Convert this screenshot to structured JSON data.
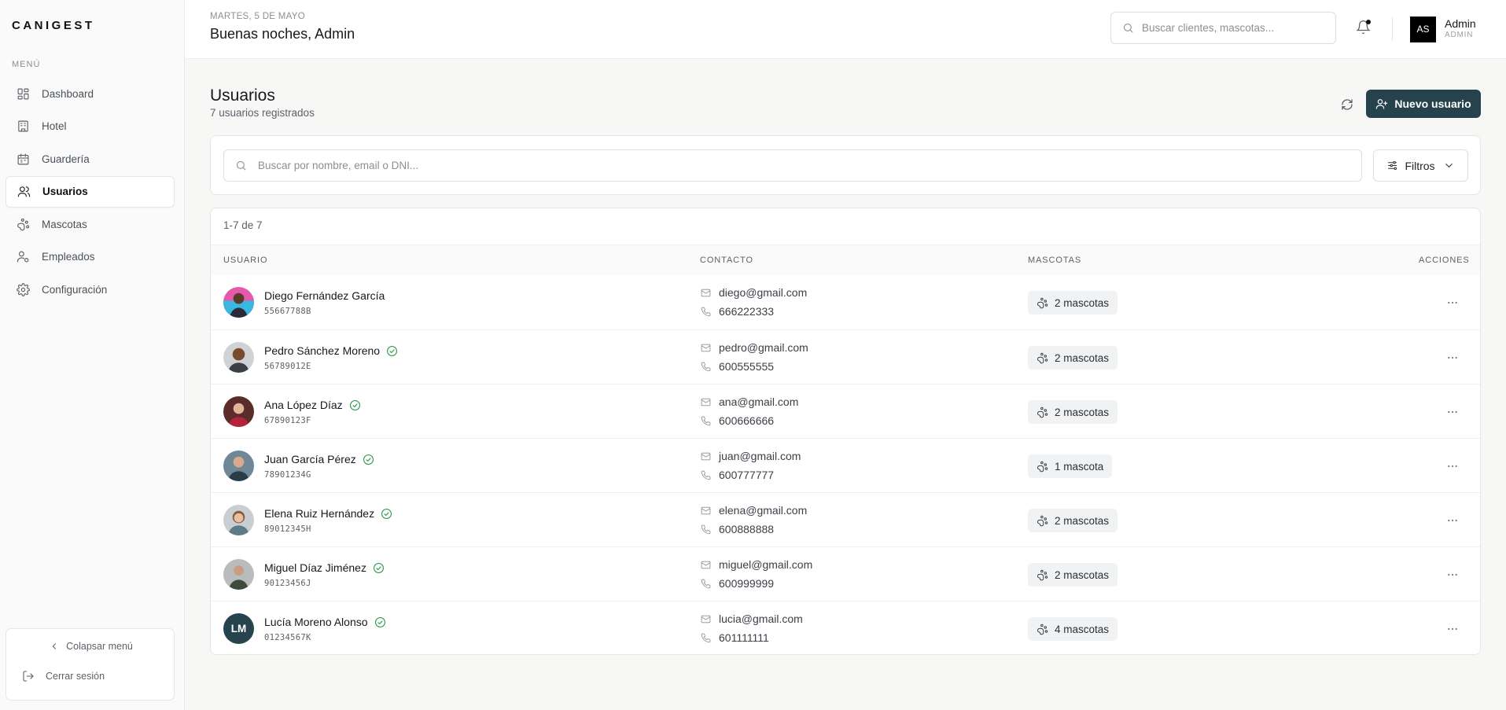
{
  "app": {
    "logo": "CANIGEST"
  },
  "sidebar": {
    "menu_label": "MENÚ",
    "items": [
      {
        "label": "Dashboard",
        "icon": "dashboard-icon",
        "active": false
      },
      {
        "label": "Hotel",
        "icon": "building-icon",
        "active": false
      },
      {
        "label": "Guardería",
        "icon": "calendar-icon",
        "active": false
      },
      {
        "label": "Usuarios",
        "icon": "users-icon",
        "active": true
      },
      {
        "label": "Mascotas",
        "icon": "paw-icon",
        "active": false
      },
      {
        "label": "Empleados",
        "icon": "employee-icon",
        "active": false
      },
      {
        "label": "Configuración",
        "icon": "gear-icon",
        "active": false
      }
    ],
    "collapse_label": "Colapsar menú",
    "logout_label": "Cerrar sesión"
  },
  "header": {
    "date": "MARTES, 5 DE MAYO",
    "greeting": "Buenas noches, Admin",
    "search_placeholder": "Buscar clientes, mascotas...",
    "user": {
      "initials": "AS",
      "name": "Admin",
      "role": "ADMIN"
    }
  },
  "page": {
    "title": "Usuarios",
    "subtitle": "7 usuarios registrados",
    "new_button": "Nuevo usuario",
    "search_placeholder": "Buscar por nombre, email o DNI...",
    "filters_button": "Filtros"
  },
  "table": {
    "range": "1-7 de 7",
    "columns": {
      "user": "USUARIO",
      "contact": "CONTACTO",
      "pets": "MASCOTAS",
      "actions": "ACCIONES"
    },
    "rows": [
      {
        "name": "Diego Fernández García",
        "dni": "55667788B",
        "verified": false,
        "email": "diego@gmail.com",
        "phone": "666222333",
        "pets": "2 mascotas",
        "avatar": "photo"
      },
      {
        "name": "Pedro Sánchez Moreno",
        "dni": "56789012E",
        "verified": true,
        "email": "pedro@gmail.com",
        "phone": "600555555",
        "pets": "2 mascotas",
        "avatar": "photo"
      },
      {
        "name": "Ana López Díaz",
        "dni": "67890123F",
        "verified": true,
        "email": "ana@gmail.com",
        "phone": "600666666",
        "pets": "2 mascotas",
        "avatar": "photo"
      },
      {
        "name": "Juan García Pérez",
        "dni": "78901234G",
        "verified": true,
        "email": "juan@gmail.com",
        "phone": "600777777",
        "pets": "1 mascota",
        "avatar": "photo"
      },
      {
        "name": "Elena Ruiz Hernández",
        "dni": "89012345H",
        "verified": true,
        "email": "elena@gmail.com",
        "phone": "600888888",
        "pets": "2 mascotas",
        "avatar": "photo"
      },
      {
        "name": "Miguel Díaz Jiménez",
        "dni": "90123456J",
        "verified": true,
        "email": "miguel@gmail.com",
        "phone": "600999999",
        "pets": "2 mascotas",
        "avatar": "photo"
      },
      {
        "name": "Lucía Moreno Alonso",
        "dni": "01234567K",
        "verified": true,
        "email": "lucia@gmail.com",
        "phone": "601111111",
        "pets": "4 mascotas",
        "avatar": "initials",
        "initials": "LM"
      }
    ]
  },
  "colors": {
    "primary": "#25424d",
    "verified": "#2e9a4a",
    "accent_dark": "#27434e"
  }
}
